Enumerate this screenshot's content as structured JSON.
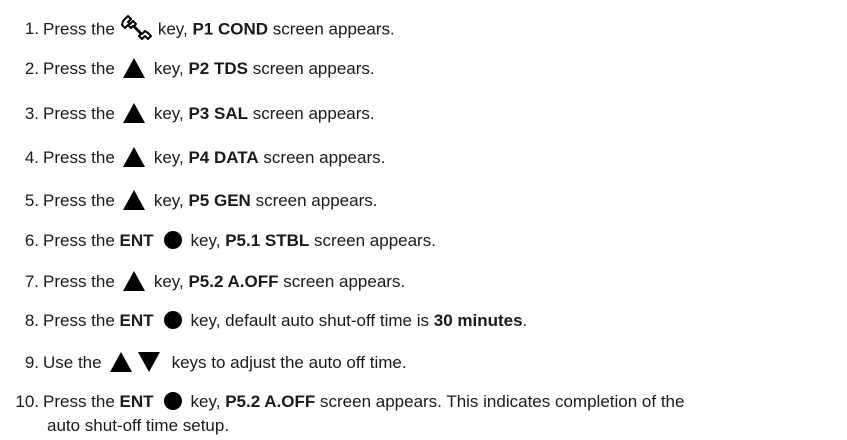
{
  "icons": {
    "wrench": "wrench-icon",
    "up": "triangle-up-icon",
    "down": "triangle-down-icon",
    "enter": "filled-circle-icon",
    "color": "#000000"
  },
  "steps": [
    {
      "num": "1.",
      "a": "Press the",
      "b": "key,",
      "c": "P1 COND",
      "d": "screen appears."
    },
    {
      "num": "2.",
      "a": "Press the",
      "b": "key,",
      "c": "P2 TDS",
      "d": "screen appears."
    },
    {
      "num": "3.",
      "a": "Press the",
      "b": "key,",
      "c": "P3 SAL",
      "d": "screen appears."
    },
    {
      "num": "4.",
      "a": "Press the",
      "b": "key,",
      "c": "P4 DATA",
      "d": "screen appears."
    },
    {
      "num": "5.",
      "a": "Press the",
      "b": "key,",
      "c": "P5 GEN",
      "d": "screen appears."
    },
    {
      "num": "6.",
      "a": "Press the",
      "ent": "ENT",
      "b": "key,",
      "c": "P5.1 STBL",
      "d": "screen appears."
    },
    {
      "num": "7.",
      "a": "Press the",
      "b": "key,",
      "c": "P5.2 A.OFF",
      "d": "screen appears."
    },
    {
      "num": "8.",
      "a": "Press the",
      "ent": "ENT",
      "b": "key, default auto shut-off time is",
      "c": "30 minutes",
      "d": "."
    },
    {
      "num": "9.",
      "a": "Use the",
      "b": "keys to adjust the auto off time."
    },
    {
      "num": "10.",
      "a": "Press the",
      "ent": "ENT",
      "b": "key,",
      "c": "P5.2 A.OFF",
      "d": "screen appears. This indicates completion of the",
      "e": "auto shut-off time setup."
    }
  ]
}
